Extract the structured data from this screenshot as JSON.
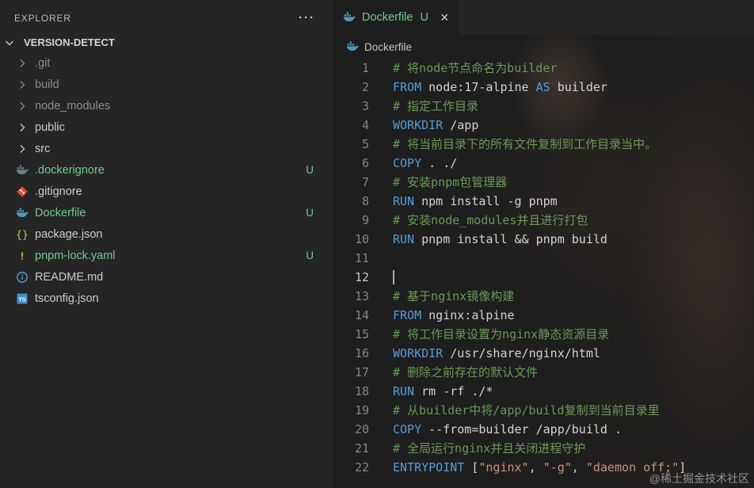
{
  "explorer": {
    "title": "EXPLORER",
    "more_icon": "···",
    "section": "VERSION-DETECT",
    "items": [
      {
        "label": ".git",
        "kind": "folder",
        "icon": "chevron-right-icon",
        "color": "dim"
      },
      {
        "label": "build",
        "kind": "folder",
        "icon": "chevron-right-icon",
        "color": "dim"
      },
      {
        "label": "node_modules",
        "kind": "folder",
        "icon": "chevron-right-icon",
        "color": "dim"
      },
      {
        "label": "public",
        "kind": "folder",
        "icon": "chevron-right-icon",
        "color": "normal"
      },
      {
        "label": "src",
        "kind": "folder",
        "icon": "chevron-right-icon",
        "color": "normal"
      },
      {
        "label": ".dockerignore",
        "kind": "file",
        "icon": "docker-icon",
        "icon_color": "#6d8086",
        "color": "green",
        "badge": "U"
      },
      {
        "label": ".gitignore",
        "kind": "file",
        "icon": "git-icon",
        "icon_color": "#dd4c35",
        "color": "normal"
      },
      {
        "label": "Dockerfile",
        "kind": "file",
        "icon": "docker-icon",
        "icon_color": "#519aba",
        "color": "green",
        "badge": "U"
      },
      {
        "label": "package.json",
        "kind": "file",
        "icon": "json-braces-icon",
        "icon_color": "#cbcb41",
        "color": "normal"
      },
      {
        "label": "pnpm-lock.yaml",
        "kind": "file",
        "icon": "pnpm-icon",
        "icon_color": "#e8c545",
        "color": "green",
        "badge": "U"
      },
      {
        "label": "README.md",
        "kind": "file",
        "icon": "info-icon",
        "icon_color": "#5aa7d4",
        "color": "normal"
      },
      {
        "label": "tsconfig.json",
        "kind": "file",
        "icon": "ts-icon",
        "icon_color": "#3b90c6",
        "color": "normal"
      }
    ]
  },
  "tab": {
    "label": "Dockerfile",
    "badge": "U",
    "close_icon": "×"
  },
  "breadcrumb": {
    "label": "Dockerfile"
  },
  "editor": {
    "current_line": 12,
    "lines": [
      [
        [
          "c",
          "# 将node节点命名为builder"
        ]
      ],
      [
        [
          "k",
          "FROM"
        ],
        [
          "p",
          " node:17-alpine "
        ],
        [
          "k",
          "AS"
        ],
        [
          "p",
          " builder"
        ]
      ],
      [
        [
          "c",
          "# 指定工作目录"
        ]
      ],
      [
        [
          "k",
          "WORKDIR"
        ],
        [
          "p",
          " /app"
        ]
      ],
      [
        [
          "c",
          "# 将当前目录下的所有文件复制到工作目录当中。"
        ]
      ],
      [
        [
          "k",
          "COPY"
        ],
        [
          "p",
          " . ./"
        ]
      ],
      [
        [
          "c",
          "# 安装pnpm包管理器"
        ]
      ],
      [
        [
          "k",
          "RUN"
        ],
        [
          "p",
          " npm install -g pnpm"
        ]
      ],
      [
        [
          "c",
          "# 安装node_modules并且进行打包"
        ]
      ],
      [
        [
          "k",
          "RUN"
        ],
        [
          "p",
          " pnpm install && pnpm build"
        ]
      ],
      [],
      [],
      [
        [
          "c",
          "# 基于nginx镜像构建"
        ]
      ],
      [
        [
          "k",
          "FROM"
        ],
        [
          "p",
          " nginx:alpine"
        ]
      ],
      [
        [
          "c",
          "# 将工作目录设置为nginx静态资源目录"
        ]
      ],
      [
        [
          "k",
          "WORKDIR"
        ],
        [
          "p",
          " /usr/share/nginx/html"
        ]
      ],
      [
        [
          "c",
          "# 删除之前存在的默认文件"
        ]
      ],
      [
        [
          "k",
          "RUN"
        ],
        [
          "p",
          " rm -rf ./*"
        ]
      ],
      [
        [
          "c",
          "# 从builder中将/app/build复制到当前目录里"
        ]
      ],
      [
        [
          "k",
          "COPY"
        ],
        [
          "p",
          " --from=builder /app/build ."
        ]
      ],
      [
        [
          "c",
          "# 全局运行nginx并且关闭进程守护"
        ]
      ],
      [
        [
          "k",
          "ENTRYPOINT"
        ],
        [
          "p",
          " ["
        ],
        [
          "s",
          "\"nginx\""
        ],
        [
          "p",
          ", "
        ],
        [
          "s",
          "\"-g\""
        ],
        [
          "p",
          ", "
        ],
        [
          "s",
          "\"daemon off;\""
        ],
        [
          "p",
          "]"
        ]
      ]
    ]
  },
  "watermark": "@稀土掘金技术社区",
  "colors": {
    "untracked_green": "#73c991",
    "keyword_blue": "#569cd6",
    "comment_green": "#6a9955",
    "string_orange": "#ce9178",
    "docker_blue": "#519aba",
    "editor_bg": "#1e1e1e",
    "sidebar_bg": "#252526",
    "ignored_gray": "#8c8c8c"
  }
}
